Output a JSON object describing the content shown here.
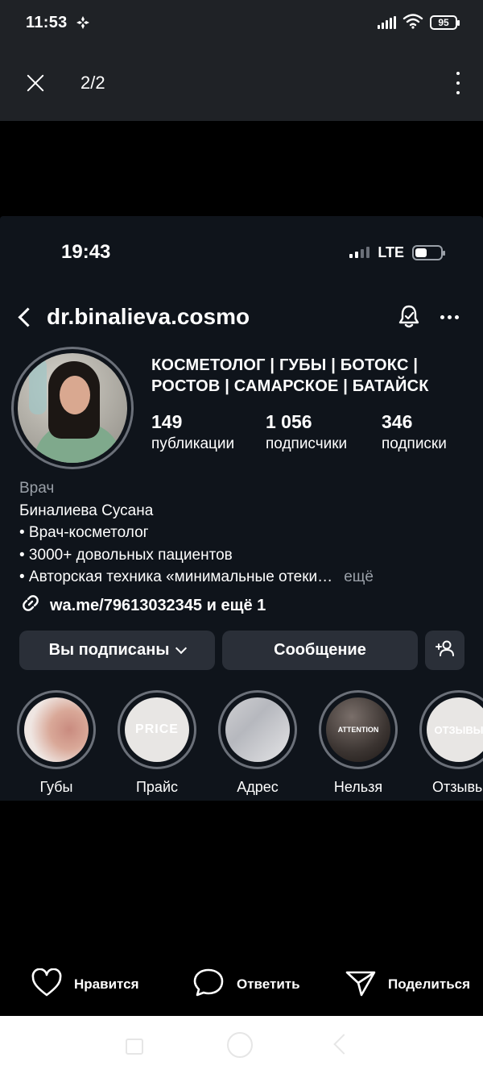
{
  "os_status": {
    "time": "11:53",
    "battery": "95"
  },
  "viewer": {
    "counter": "2/2"
  },
  "shot": {
    "status": {
      "time": "19:43",
      "network": "LTE"
    },
    "profile": {
      "username": "dr.binalieva.cosmo",
      "headline": "КОСМЕТОЛОГ | ГУБЫ | БОТОКС | РОСТОВ | САМАРСКОЕ | БАТАЙСК",
      "stats": [
        {
          "num": "149",
          "label": "публикации"
        },
        {
          "num": "1 056",
          "label": "подписчики"
        },
        {
          "num": "346",
          "label": "подписки"
        }
      ],
      "category": "Врач",
      "name": "Биналиева Сусана",
      "bio_lines": [
        "• Врач-косметолог",
        "• 3000+ довольных пациентов",
        "• Авторская техника «минимальные отеки…"
      ],
      "more": "ещё",
      "link": "wa.me/79613032345 и ещё 1"
    },
    "buttons": {
      "following": "Вы подписаны",
      "message": "Сообщение"
    },
    "highlights": [
      {
        "label": "Губы",
        "cover_text": ""
      },
      {
        "label": "Прайс",
        "cover_text": "PRICE"
      },
      {
        "label": "Адрес",
        "cover_text": ""
      },
      {
        "label": "Нельзя",
        "cover_text": "ATTENTION"
      },
      {
        "label": "Отзывы",
        "cover_text": "ОТЗЫВЫ"
      }
    ]
  },
  "actions": {
    "like": "Нравится",
    "reply": "Ответить",
    "share": "Поделиться"
  }
}
